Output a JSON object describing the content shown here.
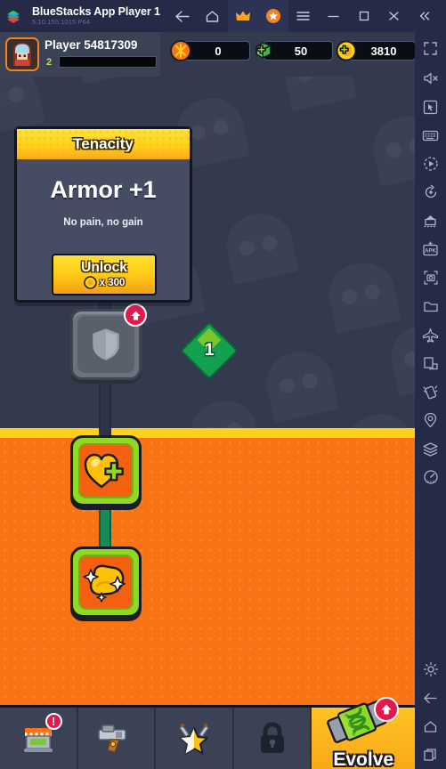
{
  "titlebar": {
    "app_title": "BlueStacks App Player 1",
    "version": "5.10.150.1015  P64",
    "buttons": [
      {
        "name": "back",
        "icon": "back-arrow-icon"
      },
      {
        "name": "home",
        "icon": "home-icon"
      },
      {
        "name": "premium",
        "icon": "crown-icon"
      },
      {
        "name": "points",
        "icon": "star-badge-icon"
      },
      {
        "name": "menu",
        "icon": "hamburger-menu-icon"
      },
      {
        "name": "minimize",
        "icon": "minimize-icon"
      },
      {
        "name": "maximize",
        "icon": "maximize-icon"
      },
      {
        "name": "close",
        "icon": "close-icon"
      },
      {
        "name": "collapse",
        "icon": "double-chevron-left-icon"
      }
    ]
  },
  "sidebar": {
    "items": [
      {
        "icon": "fullscreen-icon",
        "label": "Fullscreen"
      },
      {
        "icon": "mute-icon",
        "label": "Mute"
      },
      {
        "icon": "cursor-icon",
        "label": "Game controls"
      },
      {
        "icon": "keyboard-icon",
        "label": "Keyboard controls"
      },
      {
        "icon": "record-icon",
        "label": "Record"
      },
      {
        "icon": "rotate-icon",
        "label": "Rotate"
      },
      {
        "icon": "multi-instance-icon",
        "label": "Multi-instance"
      },
      {
        "icon": "apk-install-icon",
        "label": "Install APK"
      },
      {
        "icon": "screenshot-icon",
        "label": "Screenshot"
      },
      {
        "icon": "folder-icon",
        "label": "Media manager"
      },
      {
        "icon": "airplane-icon",
        "label": "Eco mode"
      },
      {
        "icon": "resize-icon",
        "label": "Resize"
      },
      {
        "icon": "shake-icon",
        "label": "Shake"
      },
      {
        "icon": "location-icon",
        "label": "Location"
      },
      {
        "icon": "layers-icon",
        "label": "Macros"
      },
      {
        "icon": "speedometer-icon",
        "label": "Performance"
      }
    ],
    "bottom_items": [
      {
        "icon": "gear-icon",
        "label": "Settings"
      },
      {
        "icon": "android-back-icon",
        "label": "Back"
      },
      {
        "icon": "android-home-icon",
        "label": "Home"
      },
      {
        "icon": "android-recents-icon",
        "label": "Recents"
      }
    ]
  },
  "hud": {
    "player_name": "Player 54817309",
    "level": "2",
    "avatar_icon": "player-avatar-icon",
    "currencies": [
      {
        "name": "energy",
        "icon": "energy-orb-icon",
        "value": "0"
      },
      {
        "name": "gems",
        "icon": "green-gem-icon",
        "value": "50"
      },
      {
        "name": "coins",
        "icon": "gold-coin-icon",
        "value": "3810"
      }
    ]
  },
  "card": {
    "title": "Tenacity",
    "stat": "Armor +1",
    "description": "No pain, no gain",
    "unlock_label": "Unlock",
    "unlock_cost": "x 300",
    "cost_icon": "gold-coin-icon"
  },
  "skill_tree": {
    "tier_badge": "1",
    "nodes": [
      {
        "name": "armor-node",
        "icon": "shield-icon",
        "state": "locked",
        "badge": "upgrade-arrow"
      },
      {
        "name": "health-node",
        "icon": "heart-plus-icon",
        "state": "unlocked"
      },
      {
        "name": "strength-node",
        "icon": "flexed-bicep-icon",
        "state": "unlocked"
      }
    ]
  },
  "bottom_nav": {
    "tabs": [
      {
        "name": "shop",
        "icon": "shop-icon",
        "label": "",
        "active": false,
        "badge": "!"
      },
      {
        "name": "weapons",
        "icon": "pistol-icon",
        "label": "",
        "active": false
      },
      {
        "name": "skills",
        "icon": "star-swords-icon",
        "label": "",
        "active": false
      },
      {
        "name": "locked",
        "icon": "padlock-icon",
        "label": "",
        "active": false
      },
      {
        "name": "evolve",
        "icon": "dna-syringe-icon",
        "label": "Evolve",
        "active": true,
        "badge": "upgrade-arrow"
      }
    ]
  },
  "colors": {
    "titlebar_bg": "#252a47",
    "game_bg": "#343a4e",
    "orange_zone": "#f97316",
    "accent_yellow": "#ffd21a",
    "accent_green": "#8fd923",
    "badge_red": "#e8174b"
  }
}
